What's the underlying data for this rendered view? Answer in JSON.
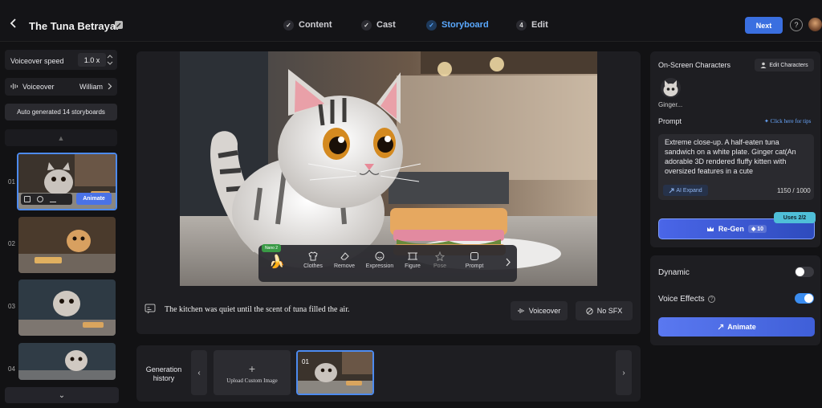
{
  "header": {
    "title": "The Tuna Betrayal",
    "steps": [
      {
        "label": "Content",
        "marker": "✓"
      },
      {
        "label": "Cast",
        "marker": "✓"
      },
      {
        "label": "Storyboard",
        "marker": "✓",
        "active": true
      },
      {
        "label": "Edit",
        "marker": "4"
      }
    ],
    "next_label": "Next",
    "help_glyph": "?"
  },
  "left": {
    "voiceover_speed_label": "Voiceover speed",
    "voiceover_speed_value": "1.0 x",
    "voiceover_label": "Voiceover",
    "voice_name": "William",
    "auto_generated": "Auto generated 14 storyboards",
    "storyboards": [
      {
        "num": "01",
        "selected": true,
        "animate_label": "Animate"
      },
      {
        "num": "02"
      },
      {
        "num": "03"
      },
      {
        "num": "04"
      }
    ]
  },
  "main": {
    "nano_badge": "Nano 2",
    "tools": [
      {
        "label": "Clothes",
        "icon": "shirt-icon"
      },
      {
        "label": "Remove",
        "icon": "eraser-icon"
      },
      {
        "label": "Expression",
        "icon": "smiley-icon"
      },
      {
        "label": "Figure",
        "icon": "figure-icon"
      },
      {
        "label": "Pose",
        "icon": "pose-icon"
      },
      {
        "label": "Prompt",
        "icon": "prompt-icon"
      }
    ],
    "caption": "The kitchen was quiet until the scent of tuna filled the air.",
    "voiceover_btn": "Voiceover",
    "sfx_btn": "No SFX",
    "history_label": "Generation history",
    "upload_label": "Upload Custom Image",
    "history_thumb_num": "01"
  },
  "right": {
    "on_screen_label": "On-Screen Characters",
    "edit_characters": "Edit Characters",
    "character_name": "Ginger...",
    "prompt_label": "Prompt",
    "tips_link": "Click here for tips",
    "prompt_text": "Extreme close-up. A half-eaten tuna sandwich on a white plate. Ginger cat(An adorable 3D rendered fluffy kitten with oversized features in a cute",
    "ai_expand": "AI Expand",
    "char_count": "1150 / 1000",
    "uses_badge": "Uses  2/2",
    "regen_label": "Re-Gen",
    "regen_cost": "10",
    "dynamic_label": "Dynamic",
    "dynamic_on": false,
    "voice_effects_label": "Voice Effects",
    "voice_effects_on": true,
    "animate_label": "Animate"
  },
  "colors": {
    "accent": "#3a6fe0",
    "active_step": "#5aa9ff",
    "toggle_on": "#3b8df0"
  }
}
